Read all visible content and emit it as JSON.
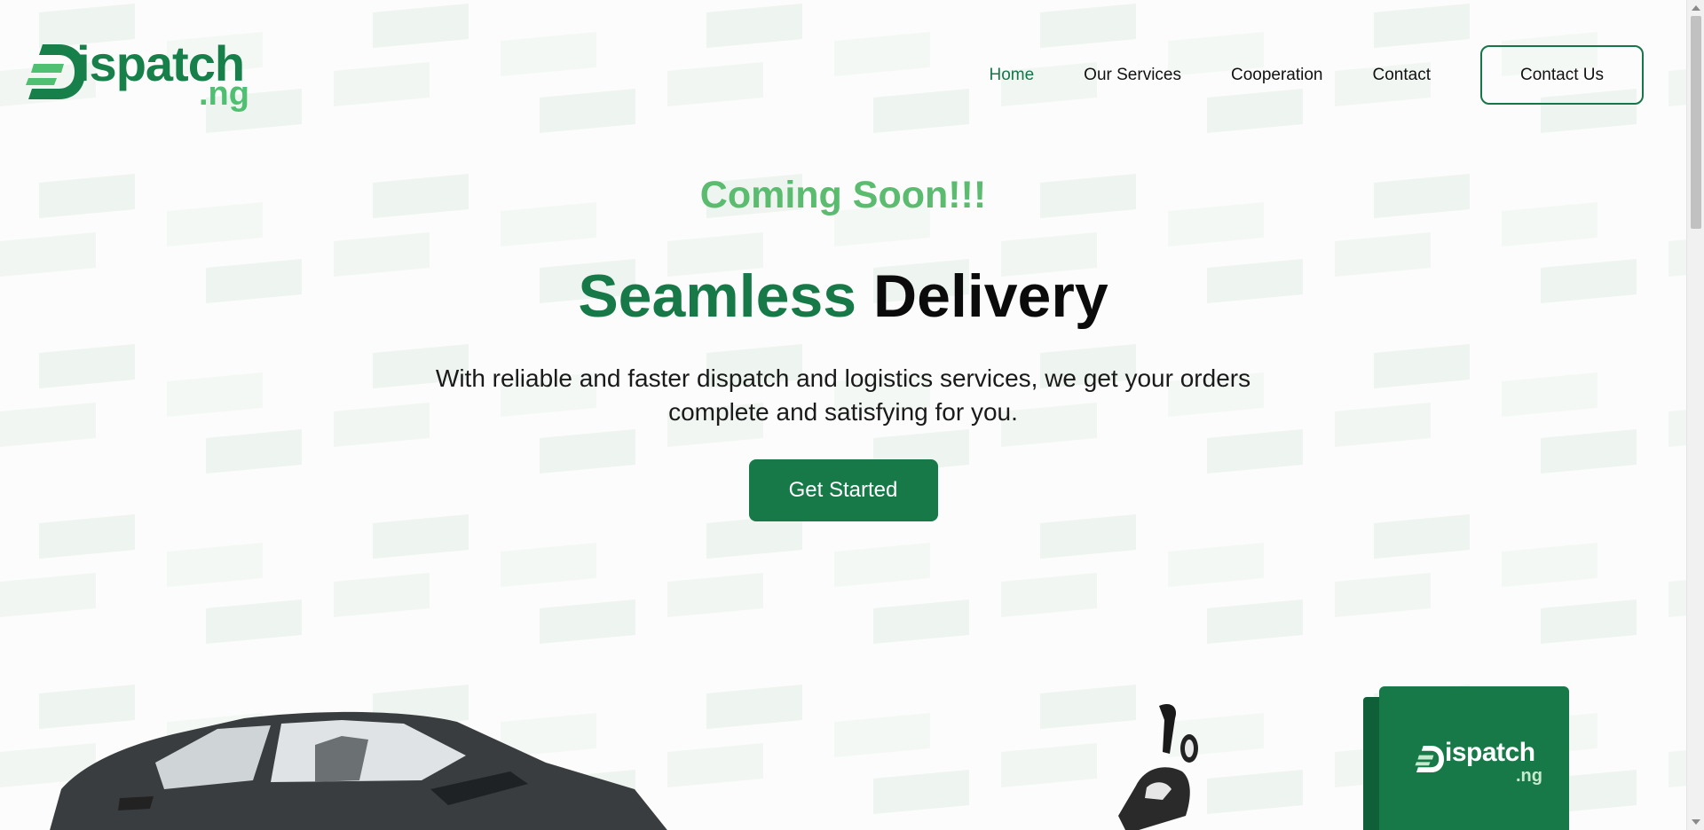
{
  "brand": {
    "name": "Dispatch",
    "logo_word": "ispatch",
    "logo_tld": ".ng",
    "primary_color": "#177848",
    "light_green": "#5bbb6f"
  },
  "nav": {
    "items": [
      {
        "label": "Home",
        "active": true
      },
      {
        "label": "Our Services",
        "active": false
      },
      {
        "label": "Cooperation",
        "active": false
      },
      {
        "label": "Contact",
        "active": false
      }
    ],
    "cta_label": "Contact Us"
  },
  "hero": {
    "badge": "Coming Soon!!!",
    "headline_accent": "Seamless",
    "headline_rest": "Delivery",
    "subtext": "With reliable and faster dispatch and logistics services, we get your orders complete and satisfying for you.",
    "cta_label": "Get Started"
  },
  "illustrations": {
    "car": "sedan-car-image",
    "scooter": "delivery-scooter-image",
    "box": "delivery-box-image",
    "box_logo_word": "ispatch",
    "box_logo_tld": ".ng"
  }
}
